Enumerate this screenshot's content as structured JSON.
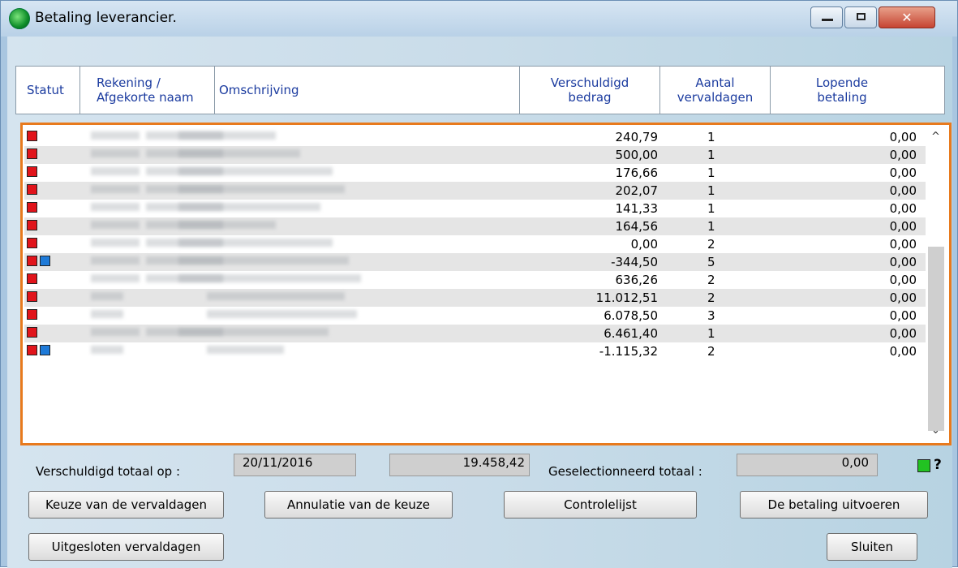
{
  "window": {
    "title": "Betaling leverancier.",
    "close_glyph": "✕"
  },
  "columns": {
    "statut": "Statut",
    "rekening_1": "Rekening /",
    "rekening_2": "Afgekorte naam",
    "omschrijving": "Omschrijving",
    "bedrag_1": "Verschuldigd",
    "bedrag_2": "bedrag",
    "aantal_1": "Aantal",
    "aantal_2": "vervaldagen",
    "lopend_1": "Lopende",
    "lopend_2": "betaling"
  },
  "rows": [
    {
      "blue": false,
      "amount": "240,79",
      "count": "1",
      "payment": "0,00"
    },
    {
      "blue": false,
      "amount": "500,00",
      "count": "1",
      "payment": "0,00"
    },
    {
      "blue": false,
      "amount": "176,66",
      "count": "1",
      "payment": "0,00"
    },
    {
      "blue": false,
      "amount": "202,07",
      "count": "1",
      "payment": "0,00"
    },
    {
      "blue": false,
      "amount": "141,33",
      "count": "1",
      "payment": "0,00"
    },
    {
      "blue": false,
      "amount": "164,56",
      "count": "1",
      "payment": "0,00"
    },
    {
      "blue": false,
      "amount": "0,00",
      "count": "2",
      "payment": "0,00"
    },
    {
      "blue": true,
      "amount": "-344,50",
      "count": "5",
      "payment": "0,00"
    },
    {
      "blue": false,
      "amount": "636,26",
      "count": "2",
      "payment": "0,00"
    },
    {
      "blue": false,
      "amount": "11.012,51",
      "count": "2",
      "payment": "0,00"
    },
    {
      "blue": false,
      "amount": "6.078,50",
      "count": "3",
      "payment": "0,00"
    },
    {
      "blue": false,
      "amount": "6.461,40",
      "count": "1",
      "payment": "0,00"
    },
    {
      "blue": true,
      "amount": "-1.115,32",
      "count": "2",
      "payment": "0,00"
    }
  ],
  "totals": {
    "due_label": "Verschuldigd totaal op :",
    "due_date": "20/11/2016",
    "due_amount": "19.458,42",
    "selected_label": "Geselectionneerd totaal :",
    "selected_amount": "0,00",
    "help": "?"
  },
  "buttons": {
    "choose_due": "Keuze van de vervaldagen",
    "cancel_choice": "Annulatie van de keuze",
    "checklist": "Controlelijst",
    "execute_payment": "De betaling uitvoeren",
    "excluded_due": "Uitgesloten vervaldagen",
    "close": "Sluiten"
  },
  "scrollbar": {
    "up": "^",
    "down": "⌄"
  }
}
